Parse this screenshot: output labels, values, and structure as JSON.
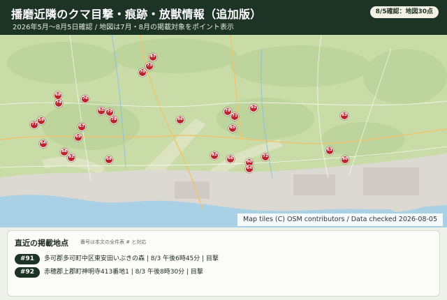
{
  "header": {
    "title": "播磨近隣のクマ目撃・痕跡・放獣情報（追加版）",
    "subtitle": "2026年5月〜8月5日確認 / 地図は7月・8月の掲載対象をポイント表示",
    "badge": "8/5確認：地図30点"
  },
  "map": {
    "attribution": "Map tiles (C) OSM contributors / Data checked 2026-08-05",
    "colors": {
      "pin": "#b8262b",
      "land": "#c9dca8",
      "sea": "#a9d0e4",
      "urban": "#dcd9d3"
    },
    "markers": [
      {
        "id": "87"
      },
      {
        "id": "73"
      },
      {
        "id": "70"
      },
      {
        "id": "68"
      },
      {
        "id": "74"
      },
      {
        "id": "76"
      },
      {
        "id": "65"
      },
      {
        "id": "75"
      },
      {
        "id": "78"
      },
      {
        "id": "77"
      },
      {
        "id": "59"
      },
      {
        "id": "67"
      },
      {
        "id": "69"
      },
      {
        "id": "64"
      },
      {
        "id": "86"
      },
      {
        "id": "88"
      },
      {
        "id": "92"
      },
      {
        "id": "68"
      },
      {
        "id": "79"
      },
      {
        "id": "71"
      },
      {
        "id": "91"
      },
      {
        "id": "85"
      },
      {
        "id": "83"
      },
      {
        "id": "82"
      },
      {
        "id": "66"
      },
      {
        "id": "72"
      },
      {
        "id": "90"
      },
      {
        "id": "64"
      },
      {
        "id": "63"
      },
      {
        "id": "80"
      }
    ]
  },
  "panel": {
    "title": "直近の掲載地点",
    "note": "番号は本文の全件表 # と対応",
    "rows": [
      {
        "num": "#91",
        "text": "多可郡多可町中区東安田いぶきの森 | 8/3 午後6時45分 | 目撃"
      },
      {
        "num": "#92",
        "text": "赤穂郡上郡町神明寺413番地1 | 8/3 午後8時30分 | 目撃"
      }
    ]
  }
}
